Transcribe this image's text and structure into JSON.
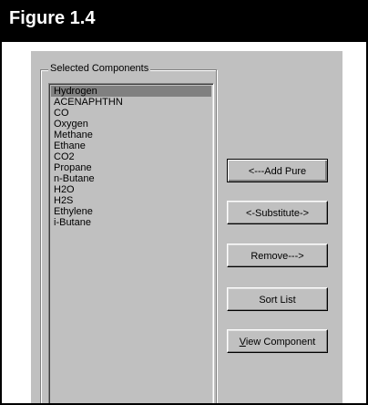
{
  "figure": {
    "title": "Figure 1.4"
  },
  "group": {
    "label": "Selected Components"
  },
  "components": [
    "Hydrogen",
    "ACENAPHTHN",
    "CO",
    "Oxygen",
    "Methane",
    "Ethane",
    "CO2",
    "Propane",
    "n-Butane",
    "H2O",
    "H2S",
    "Ethylene",
    "i-Butane"
  ],
  "selected_component": "Hydrogen",
  "buttons": {
    "add_pure": "<---Add Pure",
    "substitute": "<-Substitute->",
    "remove": "Remove--->",
    "sort_list": "Sort List",
    "view_component": "View Component"
  },
  "colors": {
    "dialog_bg": "#c0c0c0",
    "selection": "#808080",
    "header": "#000000"
  }
}
